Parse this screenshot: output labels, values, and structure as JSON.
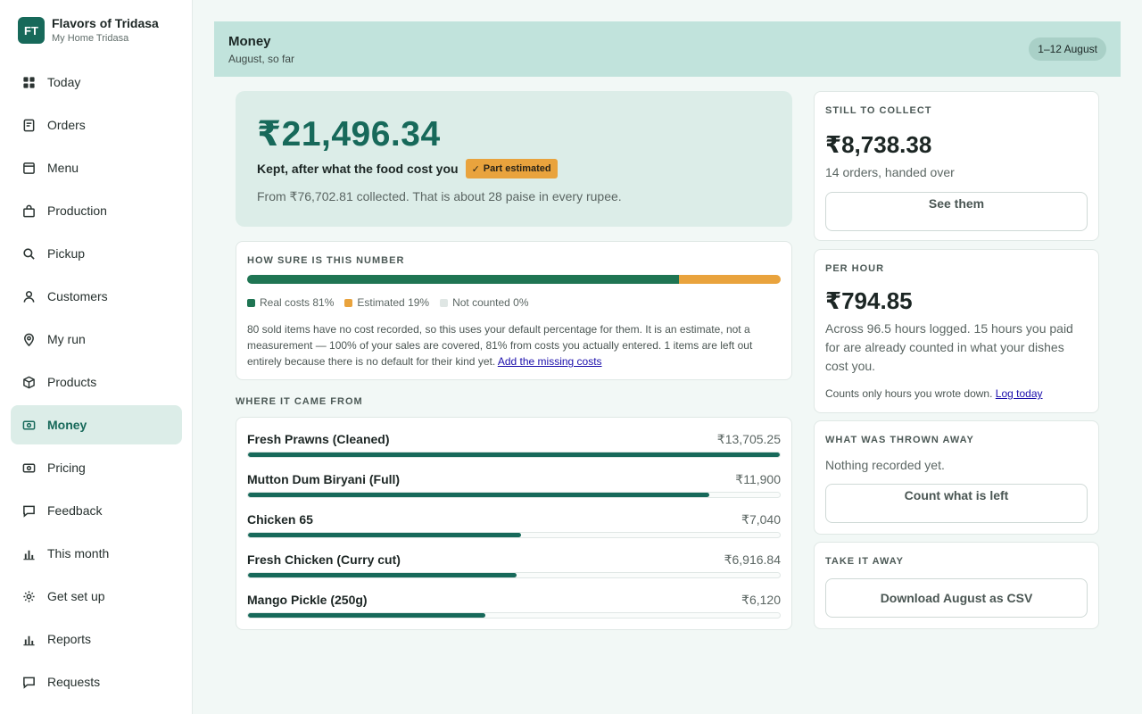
{
  "brand": {
    "initials": "FT",
    "name": "Flavors of Tridasa",
    "subtitle": "My Home Tridasa"
  },
  "nav": [
    {
      "label": "Today",
      "icon": "grid-icon",
      "active": false
    },
    {
      "label": "Orders",
      "icon": "receipt-icon",
      "active": false
    },
    {
      "label": "Menu",
      "icon": "menu-card-icon",
      "active": false
    },
    {
      "label": "Production",
      "icon": "bag-icon",
      "active": false
    },
    {
      "label": "Pickup",
      "icon": "search-icon",
      "active": false
    },
    {
      "label": "Customers",
      "icon": "user-icon",
      "active": false
    },
    {
      "label": "My run",
      "icon": "map-pin-icon",
      "active": false
    },
    {
      "label": "Products",
      "icon": "box-icon",
      "active": false
    },
    {
      "label": "Money",
      "icon": "money-icon",
      "active": true
    },
    {
      "label": "Pricing",
      "icon": "price-tag-icon",
      "active": false
    },
    {
      "label": "Feedback",
      "icon": "chat-icon",
      "active": false
    },
    {
      "label": "This month",
      "icon": "bar-chart-icon",
      "active": false
    },
    {
      "label": "Get set up",
      "icon": "gear-icon",
      "active": false
    },
    {
      "label": "Reports",
      "icon": "bar-chart-icon",
      "active": false
    },
    {
      "label": "Requests",
      "icon": "chat-icon",
      "active": false
    }
  ],
  "header": {
    "title": "Money",
    "subtitle": "August, so far",
    "range_badge": "1–12 August"
  },
  "hero": {
    "amount": "₹21,496.34",
    "label": "Kept, after what the food cost you",
    "tag": "Part estimated",
    "note": "From ₹76,702.81 collected. That is about 28 paise in every rupee."
  },
  "sure": {
    "title": "How sure is this number",
    "real_pct": 81,
    "estimated_pct": 19,
    "not_counted_pct": 0,
    "legend_real": "Real costs 81%",
    "legend_estimated": "Estimated 19%",
    "legend_not_counted": "Not counted 0%",
    "text": "80 sold items have no cost recorded, so this uses your default percentage for them. It is an estimate, not a measurement — 100% of your sales are covered, 81% from costs you actually entered. 1 items are left out entirely because there is no default for their kind yet.",
    "link": "Add the missing costs",
    "colors": {
      "real": "#1f7553",
      "estimated": "#e9a33d",
      "not_counted": "#dfe6e4"
    }
  },
  "where": {
    "title": "Where it came from",
    "rows": [
      {
        "name": "Fresh Prawns (Cleaned)",
        "value": "₹13,705.25",
        "amount": 13705.25
      },
      {
        "name": "Mutton Dum Biryani (Full)",
        "value": "₹11,900",
        "amount": 11900
      },
      {
        "name": "Chicken 65",
        "value": "₹7,040",
        "amount": 7040
      },
      {
        "name": "Fresh Chicken (Curry cut)",
        "value": "₹6,916.84",
        "amount": 6916.84
      },
      {
        "name": "Mango Pickle (250g)",
        "value": "₹6,120",
        "amount": 6120
      }
    ]
  },
  "collect": {
    "title": "Still to collect",
    "amount": "₹8,738.38",
    "note": "14 orders, handed over",
    "button": "See them"
  },
  "per_hour": {
    "title": "Per hour",
    "amount": "₹794.85",
    "text": "Across 96.5 hours logged. 15 hours you paid for are already counted in what your dishes cost you.",
    "foot": "Counts only hours you wrote down.",
    "link": "Log today"
  },
  "thrown": {
    "title": "What was thrown away",
    "note": "Nothing recorded yet.",
    "button": "Count what is left"
  },
  "take": {
    "title": "Take it away",
    "button": "Download August as CSV"
  },
  "colors": {
    "accent": "#17695a",
    "header_bg": "#c1e3dc",
    "hero_bg": "#dcede8"
  }
}
